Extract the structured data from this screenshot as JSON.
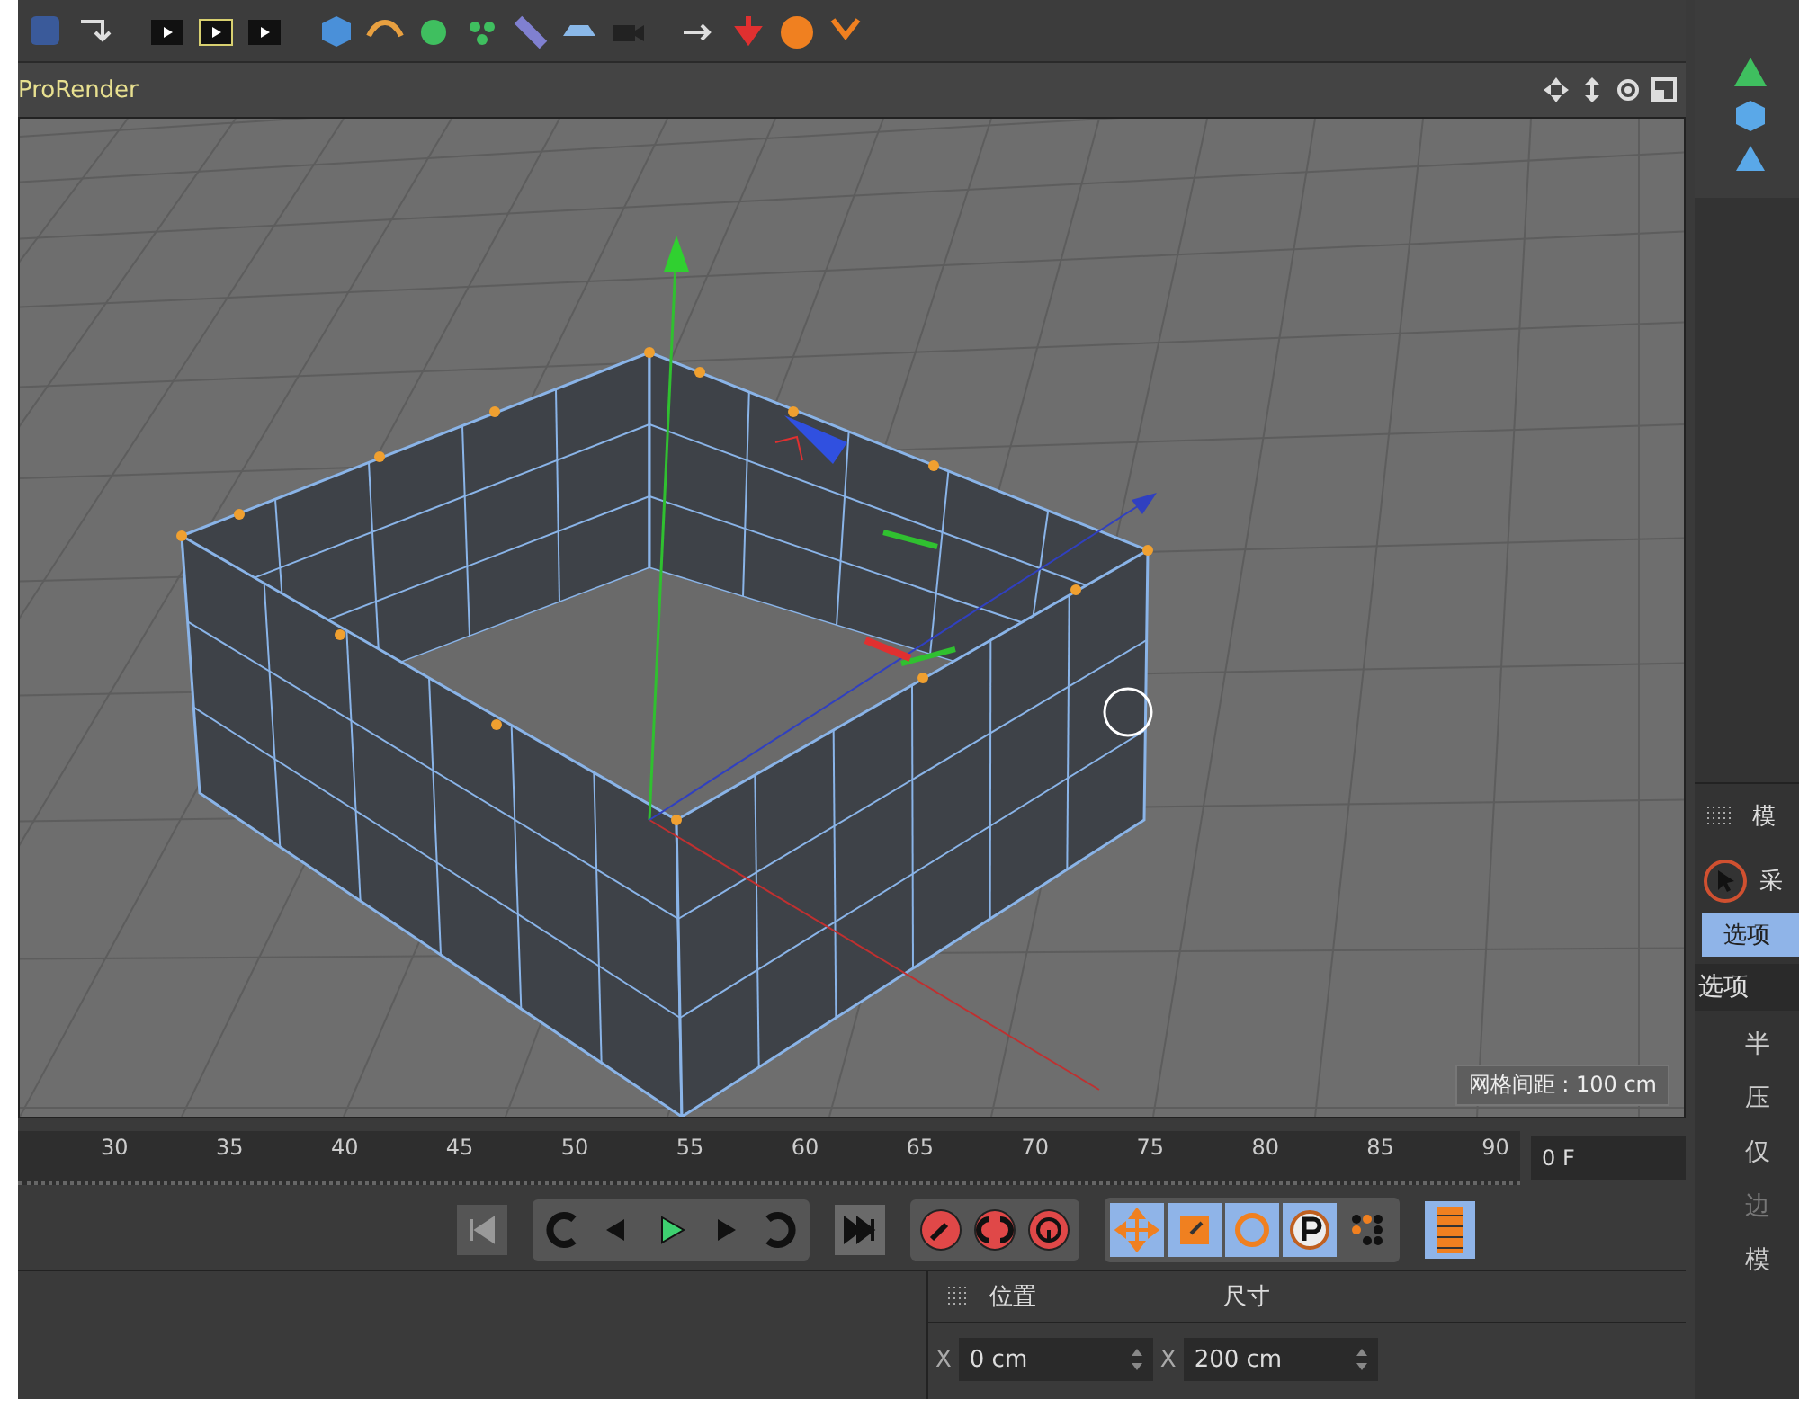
{
  "viewport": {
    "renderer": "ProRender",
    "grid_spacing": "网格间距 : 100 cm"
  },
  "timeline": {
    "ticks": [
      "30",
      "35",
      "40",
      "45",
      "50",
      "55",
      "60",
      "65",
      "70",
      "75",
      "80",
      "85",
      "90"
    ],
    "current_frame": "0 F"
  },
  "mode_tools": [
    {
      "kind": "move",
      "selected": true
    },
    {
      "kind": "scale",
      "selected": true
    },
    {
      "kind": "rotate",
      "selected": true
    },
    {
      "kind": "parameter",
      "selected": true
    },
    {
      "kind": "points",
      "selected": false
    }
  ],
  "attributes": {
    "panel_title": "模",
    "mode_label": "采",
    "tab": {
      "label": "选项",
      "selected": true
    },
    "section": "选项",
    "rows": [
      {
        "label": "半",
        "disabled": false
      },
      {
        "label": "压",
        "disabled": false
      },
      {
        "label": "仅",
        "disabled": false
      },
      {
        "label": "边",
        "disabled": true
      },
      {
        "label": "模",
        "disabled": false
      }
    ]
  },
  "coordinates": {
    "columns": [
      "位置",
      "尺寸"
    ],
    "fields": [
      {
        "axis": "X",
        "value": "0 cm"
      },
      {
        "axis": "X",
        "value": "200 cm"
      }
    ]
  }
}
